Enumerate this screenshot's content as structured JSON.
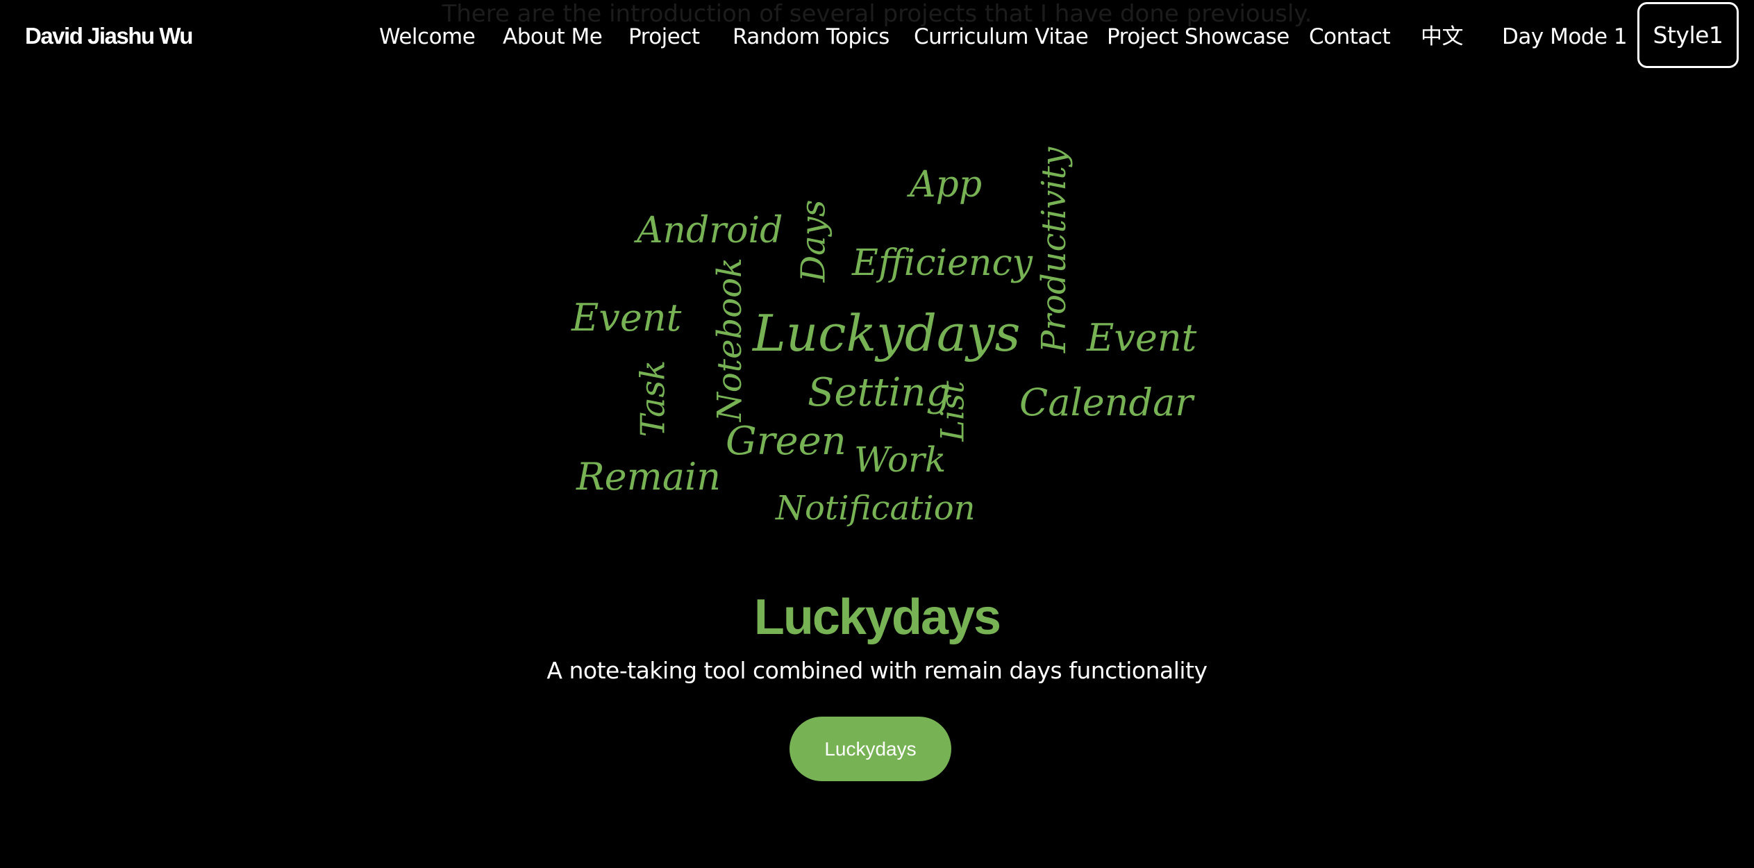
{
  "intro_text": "There are the introduction of several projects that I have done previously.",
  "brand": "David Jiashu Wu",
  "nav": {
    "items": [
      {
        "label": "Welcome"
      },
      {
        "label": "About Me"
      },
      {
        "label": "Project"
      },
      {
        "label": "Random Topics"
      },
      {
        "label": "Curriculum Vitae"
      },
      {
        "label": "Project Showcase"
      },
      {
        "label": "Contact"
      },
      {
        "label": "中文"
      },
      {
        "label": "Day Mode 1"
      }
    ],
    "style_button": "Style1"
  },
  "word_cloud": {
    "color": "#77b255",
    "words": [
      "App",
      "Android",
      "Days",
      "Efficiency",
      "Productivity",
      "Event",
      "Notebook",
      "Luckydays",
      "Event",
      "Task",
      "Setting",
      "List",
      "Calendar",
      "Green",
      "Work",
      "Remain",
      "Notification"
    ]
  },
  "hero": {
    "title": "Luckydays",
    "subtitle": "A note-taking tool combined with remain days functionality",
    "button_label": "Luckydays",
    "accent_color": "#77b255"
  }
}
